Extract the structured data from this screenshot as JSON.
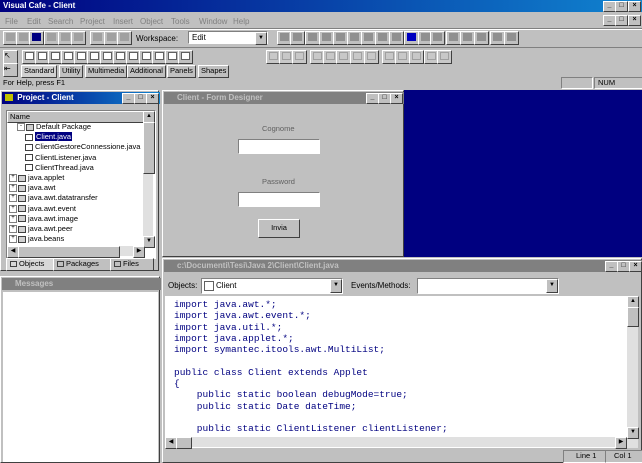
{
  "app": {
    "title": "Visual Cafe - Client"
  },
  "menu": [
    "File",
    "Edit",
    "Search",
    "Project",
    "Insert",
    "Object",
    "Tools",
    "Window",
    "Help"
  ],
  "workspace": {
    "label": "Workspace:",
    "value": "Edit"
  },
  "palette_tabs": [
    "Standard",
    "Utility",
    "Multimedia",
    "Additional",
    "Panels",
    "Shapes"
  ],
  "status": {
    "help": "For Help, press F1",
    "num": "NUM"
  },
  "project": {
    "title": "Project - Client",
    "column": "Name",
    "items": [
      {
        "label": "Default Package",
        "indent": 1,
        "toggle": "-"
      },
      {
        "label": "Client.java",
        "indent": 2,
        "toggle": "",
        "selected": true
      },
      {
        "label": "ClientGestoreConnessione.java",
        "indent": 2,
        "toggle": ""
      },
      {
        "label": "ClientListener.java",
        "indent": 2,
        "toggle": ""
      },
      {
        "label": "ClientThread.java",
        "indent": 2,
        "toggle": ""
      },
      {
        "label": "java.applet",
        "indent": 0,
        "toggle": "+"
      },
      {
        "label": "java.awt",
        "indent": 0,
        "toggle": "+"
      },
      {
        "label": "java.awt.datatransfer",
        "indent": 0,
        "toggle": "+"
      },
      {
        "label": "java.awt.event",
        "indent": 0,
        "toggle": "+"
      },
      {
        "label": "java.awt.image",
        "indent": 0,
        "toggle": "+"
      },
      {
        "label": "java.awt.peer",
        "indent": 0,
        "toggle": "+"
      },
      {
        "label": "java.beans",
        "indent": 0,
        "toggle": "+"
      }
    ],
    "tabs": [
      "Objects",
      "Packages",
      "Files"
    ]
  },
  "form": {
    "title": "Client - Form Designer",
    "cognome_label": "Cognome",
    "password_label": "Password",
    "button": "Invia"
  },
  "messages": {
    "title": "Messages"
  },
  "editor": {
    "title": "c:\\Documenti\\Tesi\\Java 2\\Client\\Client.java",
    "objects_label": "Objects:",
    "objects_value": "Client",
    "events_label": "Events/Methods:",
    "events_value": "",
    "lines": [
      "import java.awt.*;",
      "import java.awt.event.*;",
      "import java.util.*;",
      "import java.applet.*;",
      "import symantec.itools.awt.MultiList;",
      "",
      "public class Client extends Applet",
      "{",
      "    public static boolean debugMode=true;",
      "    public static Date dateTime;",
      "",
      "    public static ClientListener clientListener;"
    ],
    "line_status": "Line 1",
    "col_status": "Col 1"
  }
}
